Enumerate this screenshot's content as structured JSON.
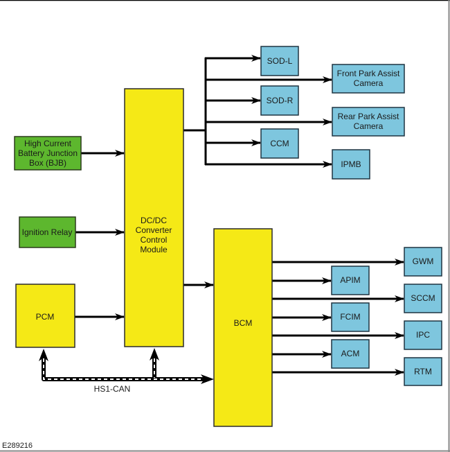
{
  "figure_id": "E289216",
  "colors": {
    "power_source": "#5db72e",
    "control_module": "#f5e916",
    "receiving_module": "#7ec6de",
    "wire": "#000000"
  },
  "blocks": {
    "bjb": "High Current\nBattery Junction\nBox (BJB)",
    "ignition_relay": "Ignition Relay",
    "pcm": "PCM",
    "dcdc": "DC/DC\nConverter\nControl\nModule",
    "bcm": "BCM",
    "sod_l": "SOD-L",
    "front_camera": "Front Park Assist\nCamera",
    "sod_r": "SOD-R",
    "rear_camera": "Rear Park Assist\nCamera",
    "ccm": "CCM",
    "ipmb": "IPMB",
    "gwm": "GWM",
    "apim": "APIM",
    "sccm": "SCCM",
    "fcim": "FCIM",
    "ipc": "IPC",
    "acm": "ACM",
    "rtm": "RTM"
  },
  "bus_label": "HS1-CAN",
  "connections": [
    {
      "from": "High Current Battery Junction Box (BJB)",
      "to": "DC/DC Converter Control Module"
    },
    {
      "from": "Ignition Relay",
      "to": "DC/DC Converter Control Module"
    },
    {
      "from": "PCM",
      "to": "DC/DC Converter Control Module"
    },
    {
      "from": "DC/DC Converter Control Module",
      "to": "SOD-L"
    },
    {
      "from": "DC/DC Converter Control Module",
      "to": "Front Park Assist Camera"
    },
    {
      "from": "DC/DC Converter Control Module",
      "to": "SOD-R"
    },
    {
      "from": "DC/DC Converter Control Module",
      "to": "Rear Park Assist Camera"
    },
    {
      "from": "DC/DC Converter Control Module",
      "to": "CCM"
    },
    {
      "from": "DC/DC Converter Control Module",
      "to": "IPMB"
    },
    {
      "from": "DC/DC Converter Control Module",
      "to": "BCM"
    },
    {
      "from": "BCM",
      "to": "GWM"
    },
    {
      "from": "BCM",
      "to": "APIM"
    },
    {
      "from": "BCM",
      "to": "SCCM"
    },
    {
      "from": "BCM",
      "to": "FCIM"
    },
    {
      "from": "BCM",
      "to": "IPC"
    },
    {
      "from": "BCM",
      "to": "ACM"
    },
    {
      "from": "BCM",
      "to": "RTM"
    },
    {
      "from": "HS1-CAN",
      "to": "PCM"
    },
    {
      "from": "HS1-CAN",
      "to": "DC/DC Converter Control Module"
    },
    {
      "from": "HS1-CAN",
      "to": "BCM"
    }
  ]
}
